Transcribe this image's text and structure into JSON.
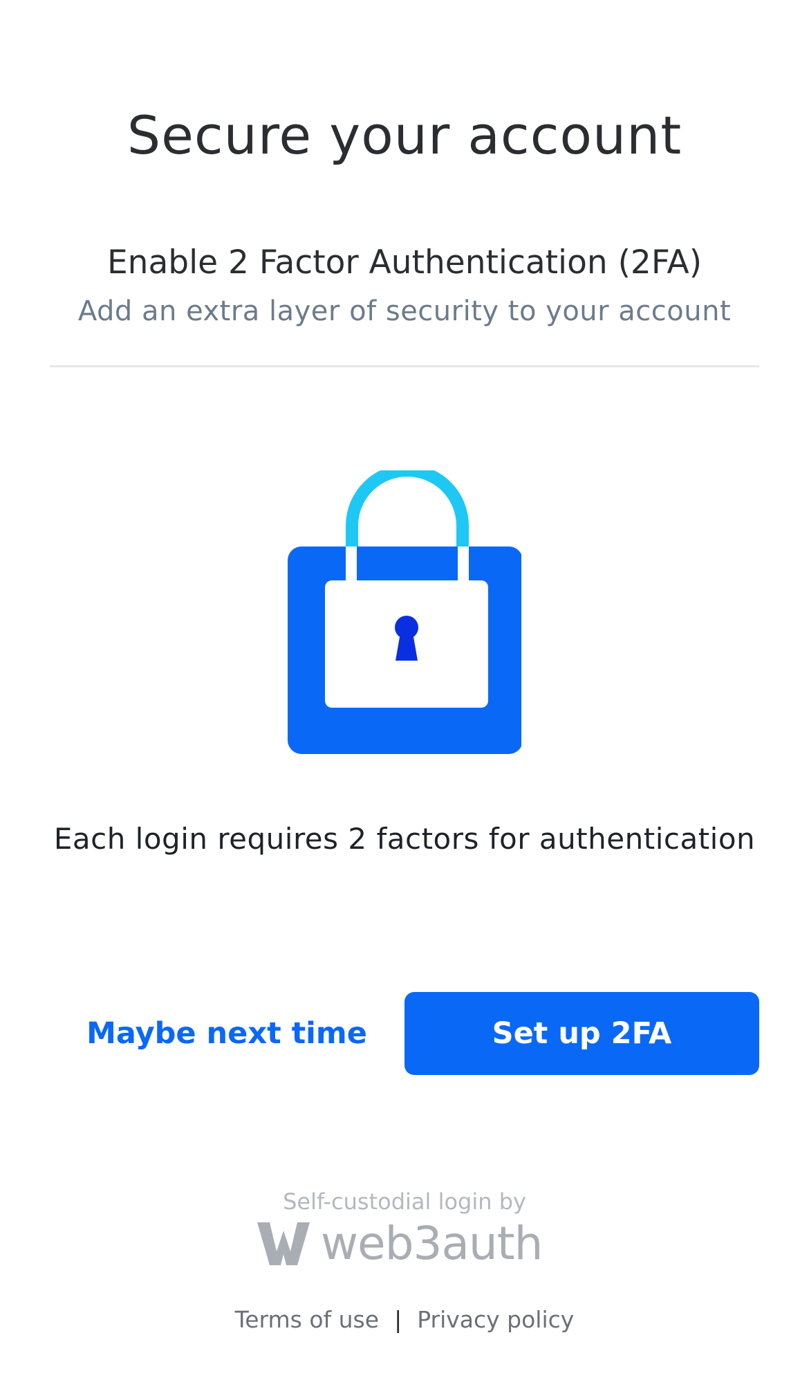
{
  "header": {
    "title": "Secure your account"
  },
  "section": {
    "title": "Enable 2 Factor Authentication (2FA)",
    "subtitle": "Add an extra layer of security to your account"
  },
  "illustration": {
    "icon": "lock-icon",
    "colors": {
      "body": "#0a68f7",
      "shackle": "#1ec8f5",
      "keyhole": "#0a2fe0",
      "inner_panel": "#ffffff"
    }
  },
  "note": "Each login requires 2 factors for authentication",
  "actions": {
    "secondary_label": "Maybe next time",
    "primary_label": "Set up 2FA"
  },
  "footer": {
    "powered_by": "Self-custodial login by",
    "brand_name": "web3auth",
    "brand_icon": "web3auth-logo-icon",
    "terms_label": "Terms of use",
    "separator": "|",
    "privacy_label": "Privacy policy"
  },
  "colors": {
    "accent": "#0a68f7",
    "muted_text": "#6c7b8c",
    "divider": "#e5e7eb"
  }
}
